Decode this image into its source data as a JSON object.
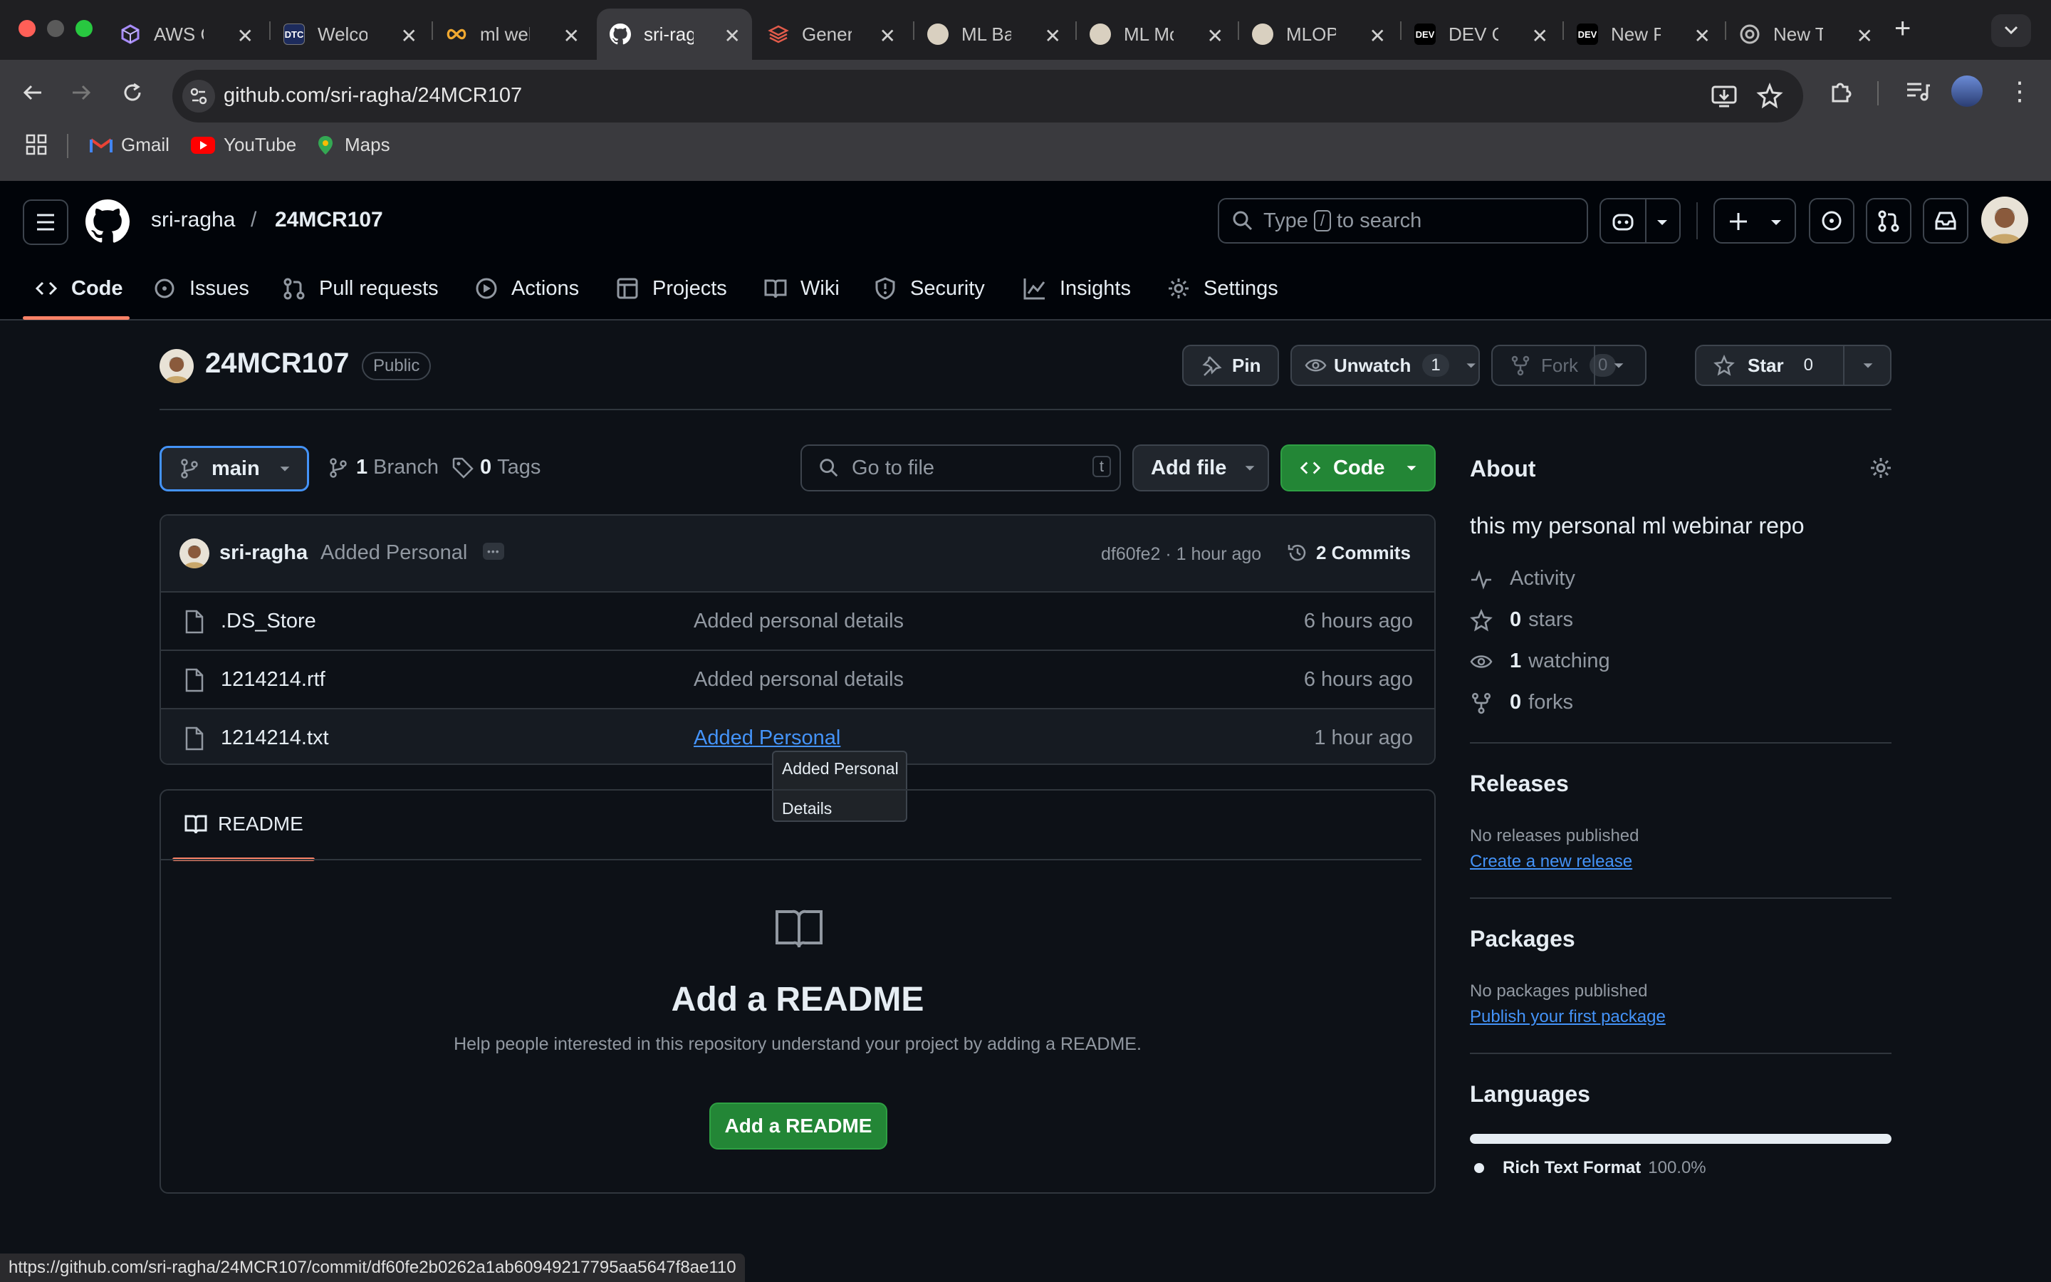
{
  "browser": {
    "tabs": [
      {
        "title": "AWS Co",
        "icon": "aws-cube-icon"
      },
      {
        "title": "Welcom",
        "icon": "dtc-icon"
      },
      {
        "title": "ml webi",
        "icon": "infinity-icon"
      },
      {
        "title": "sri-ragh",
        "icon": "github-icon",
        "active": true
      },
      {
        "title": "Genera",
        "icon": "layers-icon"
      },
      {
        "title": "ML Bas",
        "icon": "avatar-icon"
      },
      {
        "title": "ML Mo",
        "icon": "avatar-icon"
      },
      {
        "title": "MLOPS",
        "icon": "avatar-icon"
      },
      {
        "title": "DEV Co",
        "icon": "dev-icon"
      },
      {
        "title": "New Po",
        "icon": "dev-icon"
      },
      {
        "title": "New Ta",
        "icon": "chrome-icon"
      }
    ],
    "url": "github.com/sri-ragha/24MCR107",
    "bookmarks": [
      "Gmail",
      "YouTube",
      "Maps"
    ],
    "dev_badge": "DEV",
    "dtc_badge": "DTC",
    "status_url": "https://github.com/sri-ragha/24MCR107/commit/df60fe2b0262a1ab60949217795aa5647f8ae110"
  },
  "header": {
    "owner": "sri-ragha",
    "separator": "/",
    "repo": "24MCR107",
    "search_prefix": "Type",
    "search_key": "/",
    "search_suffix": "to search"
  },
  "nav": [
    {
      "label": "Code",
      "icon": "code-icon",
      "active": true
    },
    {
      "label": "Issues",
      "icon": "issue-icon"
    },
    {
      "label": "Pull requests",
      "icon": "pull-request-icon"
    },
    {
      "label": "Actions",
      "icon": "play-icon"
    },
    {
      "label": "Projects",
      "icon": "table-icon"
    },
    {
      "label": "Wiki",
      "icon": "book-icon"
    },
    {
      "label": "Security",
      "icon": "shield-icon"
    },
    {
      "label": "Insights",
      "icon": "graph-icon"
    },
    {
      "label": "Settings",
      "icon": "gear-icon"
    }
  ],
  "repo": {
    "name": "24MCR107",
    "visibility": "Public",
    "pin": "Pin",
    "unwatch": "Unwatch",
    "watch_count": "1",
    "fork": "Fork",
    "fork_count": "0",
    "star": "Star",
    "star_count": "0"
  },
  "branch": {
    "name": "main",
    "branch_count": "1",
    "branch_label": "Branch",
    "tag_count": "0",
    "tag_label": "Tags",
    "goto_placeholder": "Go to file",
    "goto_key": "t",
    "add_file": "Add file",
    "code": "Code"
  },
  "commit": {
    "author": "sri-ragha",
    "message": "Added Personal",
    "ellipsis": "•••",
    "hash_time": "df60fe2 · 1 hour ago",
    "commits": "2 Commits"
  },
  "files": [
    {
      "name": ".DS_Store",
      "message": "Added personal details",
      "time": "6 hours ago"
    },
    {
      "name": "1214214.rtf",
      "message": "Added personal details",
      "time": "6 hours ago"
    },
    {
      "name": "1214214.txt",
      "message": "Added Personal",
      "time": "1 hour ago"
    }
  ],
  "tooltip": {
    "line1": "Added Personal",
    "line2": "Details"
  },
  "readme": {
    "tab": "README",
    "title": "Add a README",
    "description": "Help people interested in this repository understand your project by adding a README.",
    "button": "Add a README"
  },
  "about": {
    "heading": "About",
    "description": "this my personal ml webinar repo",
    "activity": "Activity",
    "stars_count": "0",
    "stars_label": "stars",
    "watching_count": "1",
    "watching_label": "watching",
    "forks_count": "0",
    "forks_label": "forks"
  },
  "releases": {
    "heading": "Releases",
    "none": "No releases published",
    "link": "Create a new release"
  },
  "packages": {
    "heading": "Packages",
    "none": "No packages published",
    "link": "Publish your first package"
  },
  "languages": {
    "heading": "Languages",
    "items": [
      {
        "name": "Rich Text Format",
        "percent": "100.0%",
        "fraction": 1.0
      }
    ]
  },
  "colors": {
    "accent_green": "#238636",
    "link_blue": "#4493f8",
    "nav_underline": "#f78166",
    "background": "#0d1117"
  }
}
